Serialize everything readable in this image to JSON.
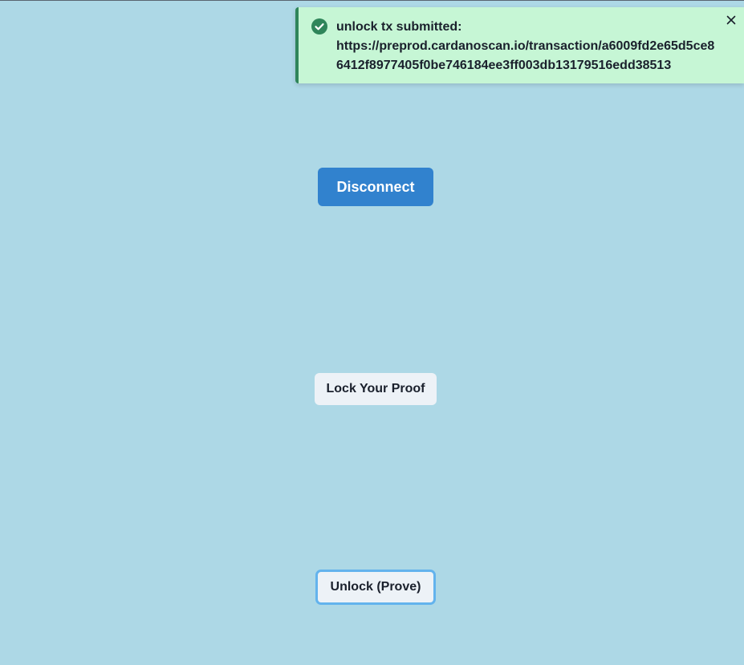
{
  "toast": {
    "status": "success",
    "icon": "check-circle-icon",
    "title": "unlock tx submitted:",
    "description_line1": "https://preprod.cardanoscan.io/transaction/a6009fd2e65d5ce8",
    "description_line2": "6412f8977405f0be746184ee3ff003db13179516edd38513",
    "close_icon": "close-icon",
    "colors": {
      "background": "#c6f6d5",
      "accent": "#2f855a"
    }
  },
  "buttons": {
    "disconnect": "Disconnect",
    "lock": "Lock Your Proof",
    "unlock": "Unlock (Prove)"
  },
  "colors": {
    "page_background": "#add8e6",
    "primary": "#3182ce",
    "focus_ring": "#63b3ed"
  }
}
